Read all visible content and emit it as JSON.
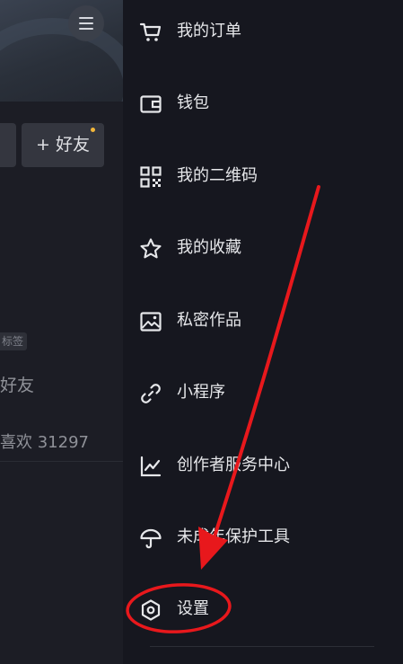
{
  "profile": {
    "add_friend_label": "+ 好友",
    "tag_label": "标签",
    "friend_text": "好友",
    "likes_text": "喜欢 31297"
  },
  "drawer": {
    "items": [
      {
        "label": "我的订单",
        "icon": "cart-icon"
      },
      {
        "label": "钱包",
        "icon": "wallet-icon"
      },
      {
        "label": "我的二维码",
        "icon": "qr-code-icon"
      },
      {
        "label": "我的收藏",
        "icon": "star-icon"
      },
      {
        "label": "私密作品",
        "icon": "private-image-icon"
      },
      {
        "label": "小程序",
        "icon": "link-icon"
      },
      {
        "label": "创作者服务中心",
        "icon": "chart-icon"
      },
      {
        "label": "未成年保护工具",
        "icon": "umbrella-icon"
      },
      {
        "label": "设置",
        "icon": "hexagon-settings-icon"
      }
    ]
  },
  "colors": {
    "background": "#16171f",
    "text": "#e6e7ea",
    "annotation": "#e8181c",
    "notification_dot": "#f2b63a"
  }
}
